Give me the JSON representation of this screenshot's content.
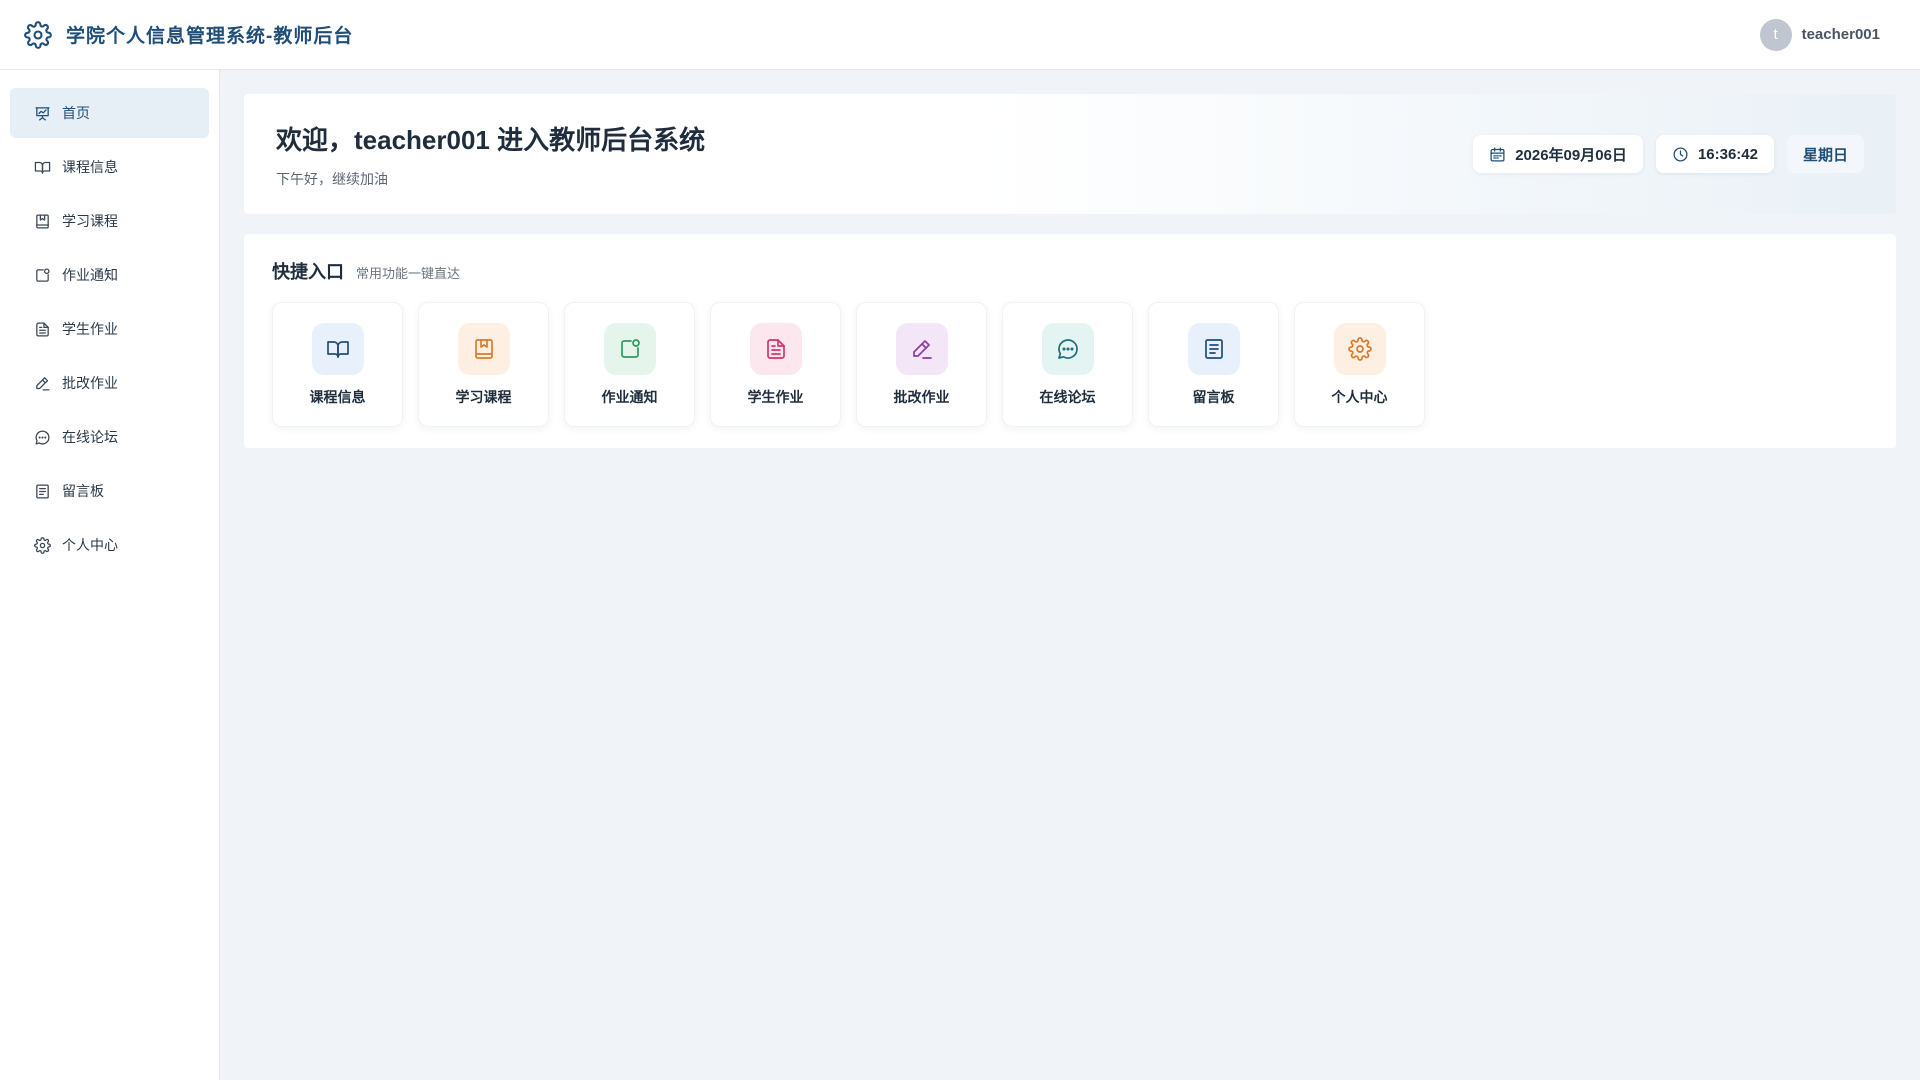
{
  "header": {
    "title": "学院个人信息管理系统-教师后台",
    "icon": "gear-icon",
    "avatar_initial": "t",
    "username": "teacher001"
  },
  "sidebar": {
    "items": [
      {
        "label": "首页",
        "icon": "presentation-icon",
        "active": true
      },
      {
        "label": "课程信息",
        "icon": "open-book-icon"
      },
      {
        "label": "学习课程",
        "icon": "bookmark-book-icon"
      },
      {
        "label": "作业通知",
        "icon": "notification-icon"
      },
      {
        "label": "学生作业",
        "icon": "document-icon"
      },
      {
        "label": "批改作业",
        "icon": "pen-icon"
      },
      {
        "label": "在线论坛",
        "icon": "chat-bubble-icon"
      },
      {
        "label": "留言板",
        "icon": "notepad-icon"
      },
      {
        "label": "个人中心",
        "icon": "gear-icon"
      }
    ]
  },
  "welcome": {
    "title": "欢迎，teacher001 进入教师后台系统",
    "subtitle": "下午好，继续加油",
    "date": "2026年09月06日",
    "time": "16:36:42",
    "weekday": "星期日"
  },
  "quick": {
    "title": "快捷入口",
    "subtitle": "常用功能一键直达",
    "cards": [
      {
        "label": "课程信息",
        "icon": "open-book-icon",
        "bg": "#e8f1fb",
        "color": "#1f4e79"
      },
      {
        "label": "学习课程",
        "icon": "bookmark-book-icon",
        "bg": "#fdf0e3",
        "color": "#d97a2b"
      },
      {
        "label": "作业通知",
        "icon": "notification-icon",
        "bg": "#e6f5ec",
        "color": "#2e9b5e"
      },
      {
        "label": "学生作业",
        "icon": "document-icon",
        "bg": "#fde7ee",
        "color": "#d6336c"
      },
      {
        "label": "批改作业",
        "icon": "pen-icon",
        "bg": "#f3e6f7",
        "color": "#8e3aa8"
      },
      {
        "label": "在线论坛",
        "icon": "chat-bubble-icon",
        "bg": "#e4f4f3",
        "color": "#1f6f7a"
      },
      {
        "label": "留言板",
        "icon": "notepad-icon",
        "bg": "#e8f1fb",
        "color": "#1f4e79"
      },
      {
        "label": "个人中心",
        "icon": "gear-icon",
        "bg": "#fdf0e3",
        "color": "#d97a2b"
      }
    ]
  },
  "colors": {
    "primary": "#1f4e79",
    "background": "#f0f4f8",
    "active_nav_bg": "#e6eef6"
  }
}
